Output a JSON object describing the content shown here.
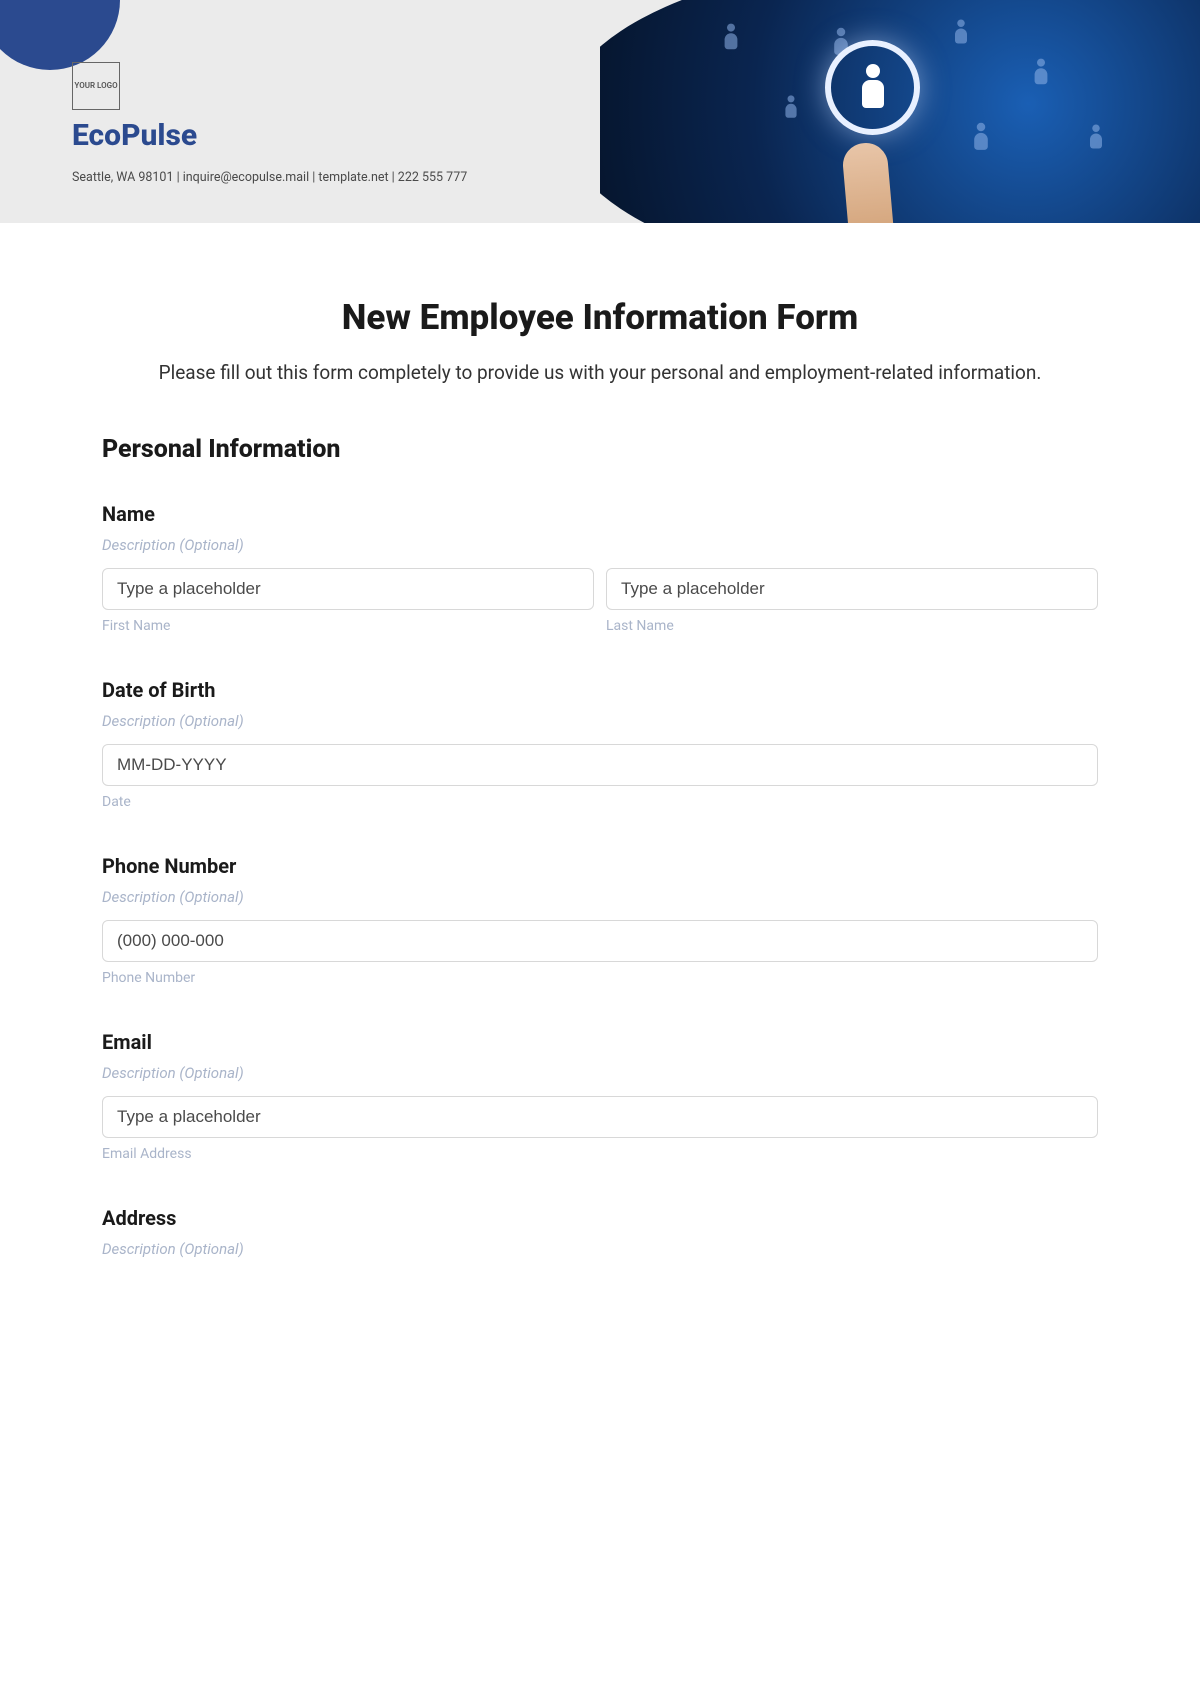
{
  "header": {
    "logo_text": "YOUR LOGO",
    "brand": "EcoPulse",
    "contact": "Seattle, WA 98101 | inquire@ecopulse.mail | template.net | 222 555 777"
  },
  "form": {
    "title": "New Employee Information Form",
    "intro": "Please fill out this form completely to provide us with your personal and employment-related information.",
    "section1_title": "Personal Information",
    "desc_optional": "Description (Optional)",
    "name": {
      "label": "Name",
      "first_placeholder": "Type a placeholder",
      "first_sub": "First Name",
      "last_placeholder": "Type a placeholder",
      "last_sub": "Last Name"
    },
    "dob": {
      "label": "Date of Birth",
      "placeholder": "MM-DD-YYYY",
      "sub": "Date"
    },
    "phone": {
      "label": "Phone Number",
      "placeholder": "(000) 000-000",
      "sub": "Phone Number"
    },
    "email": {
      "label": "Email",
      "placeholder": "Type a placeholder",
      "sub": "Email Address"
    },
    "address": {
      "label": "Address"
    }
  }
}
